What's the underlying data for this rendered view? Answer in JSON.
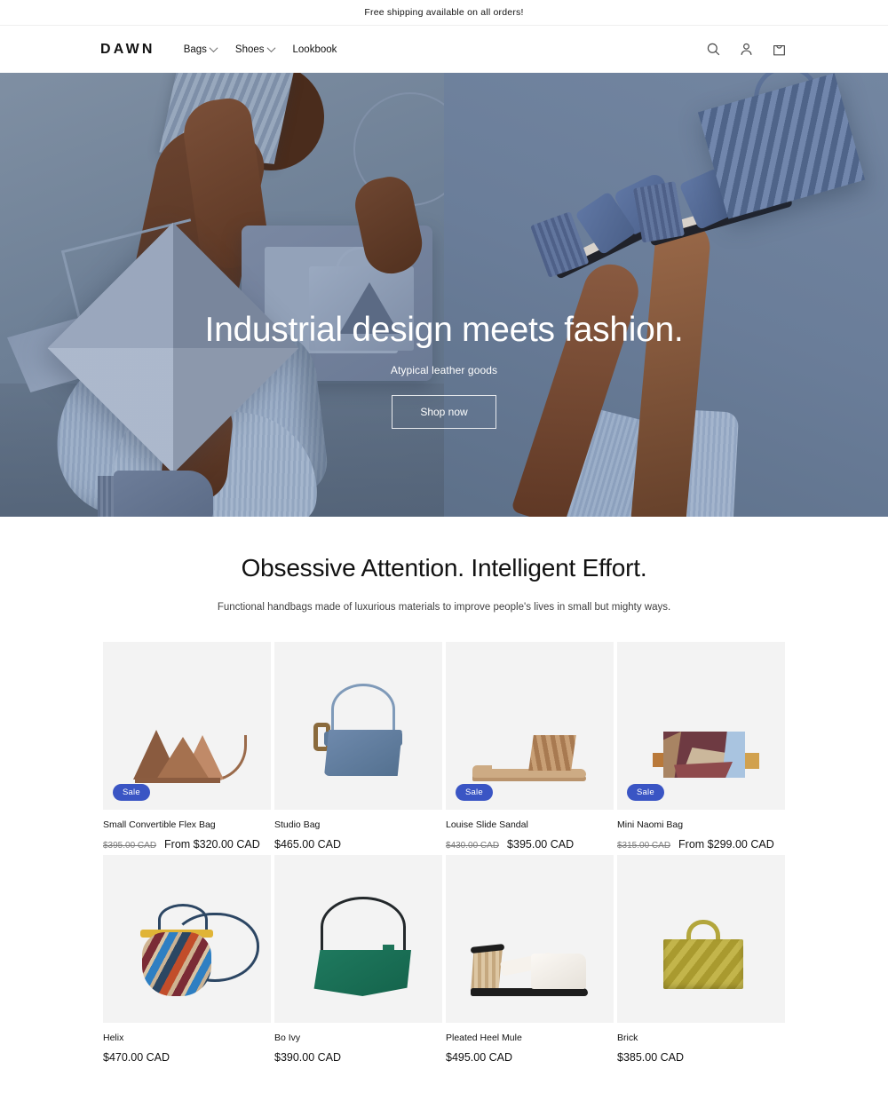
{
  "announcement": {
    "text": "Free shipping available on all orders!"
  },
  "header": {
    "logo": "DAWN",
    "nav": [
      {
        "label": "Bags",
        "has_dropdown": true
      },
      {
        "label": "Shoes",
        "has_dropdown": true
      },
      {
        "label": "Lookbook",
        "has_dropdown": false
      }
    ],
    "icons": [
      {
        "name": "search-icon",
        "label": "Search"
      },
      {
        "name": "account-icon",
        "label": "Log in"
      },
      {
        "name": "cart-icon",
        "label": "Cart"
      }
    ]
  },
  "hero": {
    "title": "Industrial design meets fashion.",
    "subtitle": "Atypical leather goods",
    "button": "Shop now"
  },
  "richtext": {
    "title": "Obsessive Attention. Intelligent Effort.",
    "subtitle": "Functional handbags made of luxurious materials to improve people's lives in small but mighty ways."
  },
  "badges": {
    "sale": "Sale",
    "sale_color": "#3a55c4"
  },
  "products": [
    {
      "title": "Small Convertible Flex Bag",
      "compare_price": "$395.00 CAD",
      "price": "From $320.00 CAD",
      "on_sale": true,
      "badge": "Sale"
    },
    {
      "title": "Studio Bag",
      "compare_price": "",
      "price": "$465.00 CAD",
      "on_sale": false,
      "badge": ""
    },
    {
      "title": "Louise Slide Sandal",
      "compare_price": "$430.00 CAD",
      "price": "$395.00 CAD",
      "on_sale": true,
      "badge": "Sale"
    },
    {
      "title": "Mini Naomi Bag",
      "compare_price": "$315.00 CAD",
      "price": "From $299.00 CAD",
      "on_sale": true,
      "badge": "Sale"
    },
    {
      "title": "Helix",
      "compare_price": "",
      "price": "$470.00 CAD",
      "on_sale": false,
      "badge": ""
    },
    {
      "title": "Bo Ivy",
      "compare_price": "",
      "price": "$390.00 CAD",
      "on_sale": false,
      "badge": ""
    },
    {
      "title": "Pleated Heel Mule",
      "compare_price": "",
      "price": "$495.00 CAD",
      "on_sale": false,
      "badge": ""
    },
    {
      "title": "Brick",
      "compare_price": "",
      "price": "$385.00 CAD",
      "on_sale": false,
      "badge": ""
    }
  ]
}
